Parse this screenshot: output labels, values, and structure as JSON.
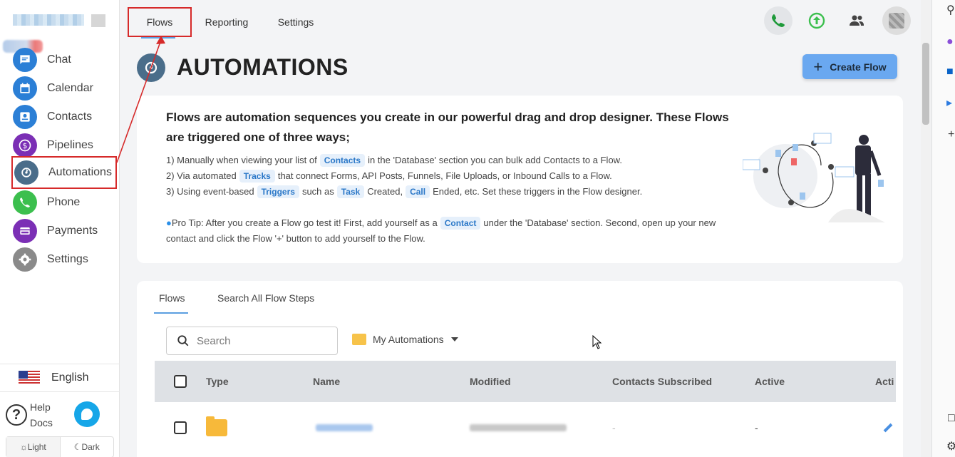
{
  "sidebar": {
    "items": [
      {
        "label": "Chat",
        "icon": "chat-icon",
        "color": "#2b7fd6"
      },
      {
        "label": "Calendar",
        "icon": "calendar-icon",
        "color": "#2b7fd6"
      },
      {
        "label": "Contacts",
        "icon": "contacts-icon",
        "color": "#2b7fd6"
      },
      {
        "label": "Pipelines",
        "icon": "dollar-icon",
        "color": "#7b2fb5"
      },
      {
        "label": "Automations",
        "icon": "automation-icon",
        "color": "#4a6d8a"
      },
      {
        "label": "Phone",
        "icon": "phone-icon",
        "color": "#3cbf4e"
      },
      {
        "label": "Payments",
        "icon": "payments-icon",
        "color": "#7b2fb5"
      },
      {
        "label": "Settings",
        "icon": "gear-icon",
        "color": "#8a8a8a"
      }
    ],
    "language": "English",
    "help_line1": "Help",
    "help_line2": "Docs",
    "help_symbol": "?",
    "theme_light": "Light",
    "theme_dark": "Dark",
    "theme_light_glyph": "☼",
    "theme_dark_glyph": "☾"
  },
  "topnav": {
    "tabs": [
      "Flows",
      "Reporting",
      "Settings"
    ]
  },
  "header": {
    "title": "AUTOMATIONS",
    "create_button": "Create Flow",
    "create_button_glyph": "+"
  },
  "info": {
    "heading": "Flows are automation sequences you create in our powerful drag and drop designer. These Flows are triggered one of three ways;",
    "line1_a": "1) Manually when viewing your list of",
    "line1_chip": "Contacts",
    "line1_b": "in the 'Database' section you can bulk add Contacts to a Flow.",
    "line2_a": "2) Via automated",
    "line2_chip": "Tracks",
    "line2_b": "that connect Forms, API Posts, Funnels, File Uploads, or Inbound Calls to a Flow.",
    "line3_a": "3) Using event-based",
    "line3_chip1": "Triggers",
    "line3_b": "such as",
    "line3_chip2": "Task",
    "line3_c": "Created,",
    "line3_chip3": "Call",
    "line3_d": "Ended, etc. Set these triggers in the Flow designer.",
    "tip_a": "Pro Tip: After you create a Flow go test it! First, add yourself as a",
    "tip_chip": "Contact",
    "tip_b": "under the 'Database' section. Second, open up your new contact and click the Flow '+' button to add yourself to the Flow."
  },
  "flows": {
    "tabs": [
      "Flows",
      "Search All Flow Steps"
    ],
    "search_placeholder": "Search",
    "folder_label": "My Automations",
    "columns": [
      "Type",
      "Name",
      "Modified",
      "Contacts Subscribed",
      "Active",
      "Acti"
    ],
    "rows": [
      {
        "type": "folder",
        "contacts": "-",
        "active": "-"
      }
    ]
  },
  "colors": {
    "accent": "#6aa8f0",
    "highlight": "#d62a2a",
    "chip_bg": "#e6f0fb",
    "chip_text": "#2b78c8"
  }
}
